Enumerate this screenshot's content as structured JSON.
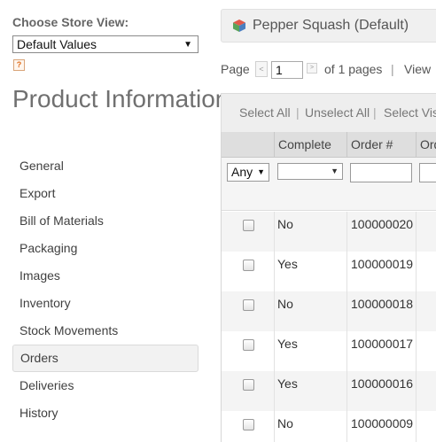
{
  "store": {
    "label": "Choose Store View:",
    "selected": "Default Values",
    "help_icon": "?"
  },
  "product_title": "Product Information",
  "nav": [
    {
      "label": "General"
    },
    {
      "label": "Export"
    },
    {
      "label": "Bill of Materials"
    },
    {
      "label": "Packaging"
    },
    {
      "label": "Images"
    },
    {
      "label": "Inventory"
    },
    {
      "label": "Stock Movements"
    },
    {
      "label": "Orders",
      "active": true
    },
    {
      "label": "Deliveries"
    },
    {
      "label": "History"
    }
  ],
  "header": {
    "icon": "cube-icon",
    "title": "Pepper Squash (Default)"
  },
  "pager": {
    "page_label": "Page",
    "page_value": "1",
    "of_pages": "of 1 pages",
    "separator": "|",
    "view_label": "View",
    "prev_icon": "<",
    "next_icon": ">"
  },
  "massaction": {
    "select_all": "Select All",
    "unselect_all": "Unselect All",
    "select_visible": "Select Visible",
    "separator": "|"
  },
  "grid": {
    "columns": [
      "",
      "Complete",
      "Order #",
      "Ord"
    ],
    "filter_any": "Any",
    "rows": [
      {
        "complete": "No",
        "order": "100000020"
      },
      {
        "complete": "Yes",
        "order": "100000019"
      },
      {
        "complete": "No",
        "order": "100000018"
      },
      {
        "complete": "Yes",
        "order": "100000017"
      },
      {
        "complete": "Yes",
        "order": "100000016"
      },
      {
        "complete": "No",
        "order": "100000009"
      }
    ]
  }
}
